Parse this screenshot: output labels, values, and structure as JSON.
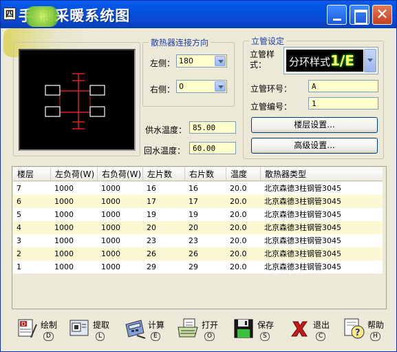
{
  "window": {
    "icon_glyph": "四",
    "title": "手 制采暖系统图"
  },
  "connection": {
    "legend": "散热器连接方向",
    "left_label": "左侧：",
    "left_value": "180",
    "right_label": "右侧：",
    "right_value": "0",
    "supply_label": "供水温度：",
    "supply_value": "85.00",
    "return_label": "回水温度：",
    "return_value": "60.00"
  },
  "riser": {
    "legend": "立管设定",
    "style_label": "立管样式：",
    "style_value": "分环样式",
    "style_highlight": "1/E",
    "ring_label": "立管环号：",
    "ring_value": "A",
    "number_label": "立管编号：",
    "number_value": "1",
    "floor_button": "楼层设置...",
    "advanced_button": "高级设置..."
  },
  "table": {
    "headers": [
      "楼层",
      "左负荷(W)",
      "右负荷(W)",
      "左片数",
      "右片数",
      "温度",
      "散热器类型"
    ],
    "rows": [
      [
        "7",
        "1000",
        "1000",
        "16",
        "16",
        "20.0",
        "北京森德3柱钢管3045"
      ],
      [
        "6",
        "1000",
        "1000",
        "17",
        "17",
        "20.0",
        "北京森德3柱钢管3045"
      ],
      [
        "5",
        "1000",
        "1000",
        "19",
        "19",
        "20.0",
        "北京森德3柱钢管3045"
      ],
      [
        "4",
        "1000",
        "1000",
        "20",
        "20",
        "20.0",
        "北京森德3柱钢管3045"
      ],
      [
        "3",
        "1000",
        "1000",
        "23",
        "23",
        "20.0",
        "北京森德3柱钢管3045"
      ],
      [
        "2",
        "1000",
        "1000",
        "26",
        "26",
        "20.0",
        "北京森德3柱钢管3045"
      ],
      [
        "1",
        "1000",
        "1000",
        "29",
        "29",
        "20.0",
        "北京森德3柱钢管3045"
      ]
    ],
    "row_colors": [
      "#ffffff",
      "#fbf8d3"
    ]
  },
  "toolbar": [
    {
      "icon": "draw-icon",
      "label": "绘制",
      "key": "D"
    },
    {
      "icon": "extract-icon",
      "label": "提取",
      "key": "L"
    },
    {
      "icon": "calculator-icon",
      "label": "计算",
      "key": "E"
    },
    {
      "icon": "open-folder-icon",
      "label": "打开",
      "key": "O"
    },
    {
      "icon": "save-disk-icon",
      "label": "保存",
      "key": "S"
    },
    {
      "icon": "exit-x-icon",
      "label": "退出",
      "key": "C"
    },
    {
      "icon": "help-icon",
      "label": "帮助",
      "key": "H"
    }
  ],
  "colors": {
    "titlebar": "#0054e3",
    "field_bg": "#ffffcc",
    "accent_red": "#e02020"
  }
}
